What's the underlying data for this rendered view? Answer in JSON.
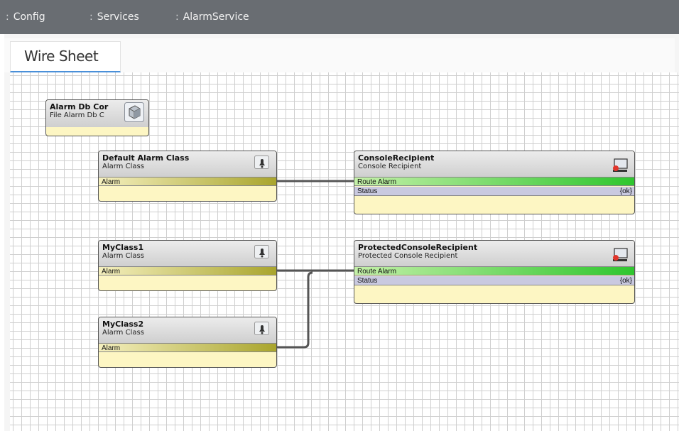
{
  "breadcrumb": {
    "separator": ":",
    "items": [
      "Config",
      "Services",
      "AlarmService"
    ]
  },
  "tab": {
    "label": "Wire Sheet"
  },
  "nodes": {
    "alarm_db": {
      "name": "Alarm Db Cor",
      "type": "File Alarm Db C",
      "icon": "cube-icon"
    },
    "default_class": {
      "name": "Default Alarm Class",
      "type": "Alarm Class",
      "slot": "Alarm",
      "icon": "alarm-bell-icon"
    },
    "myclass1": {
      "name": "MyClass1",
      "type": "Alarm Class",
      "slot": "Alarm",
      "icon": "alarm-bell-icon"
    },
    "myclass2": {
      "name": "MyClass2",
      "type": "Alarm Class",
      "slot": "Alarm",
      "icon": "alarm-bell-icon"
    },
    "console": {
      "name": "ConsoleRecipient",
      "type": "Console Recipient",
      "route": "Route Alarm",
      "status_label": "Status",
      "status_value": "{ok}",
      "icon": "console-monitor-icon"
    },
    "protected": {
      "name": "ProtectedConsoleRecipient",
      "type": "Protected Console Recipient",
      "route": "Route Alarm",
      "status_label": "Status",
      "status_value": "{ok}",
      "icon": "console-monitor-icon"
    }
  },
  "colors": {
    "topbar": "#696d72",
    "alarm_slot": "#a9a52d",
    "route_slot": "#2fc62f",
    "status_slot": "#c9c9e0",
    "node_body": "#fdf6c3",
    "tab_accent": "#4a90d9",
    "wire": "#555555"
  }
}
